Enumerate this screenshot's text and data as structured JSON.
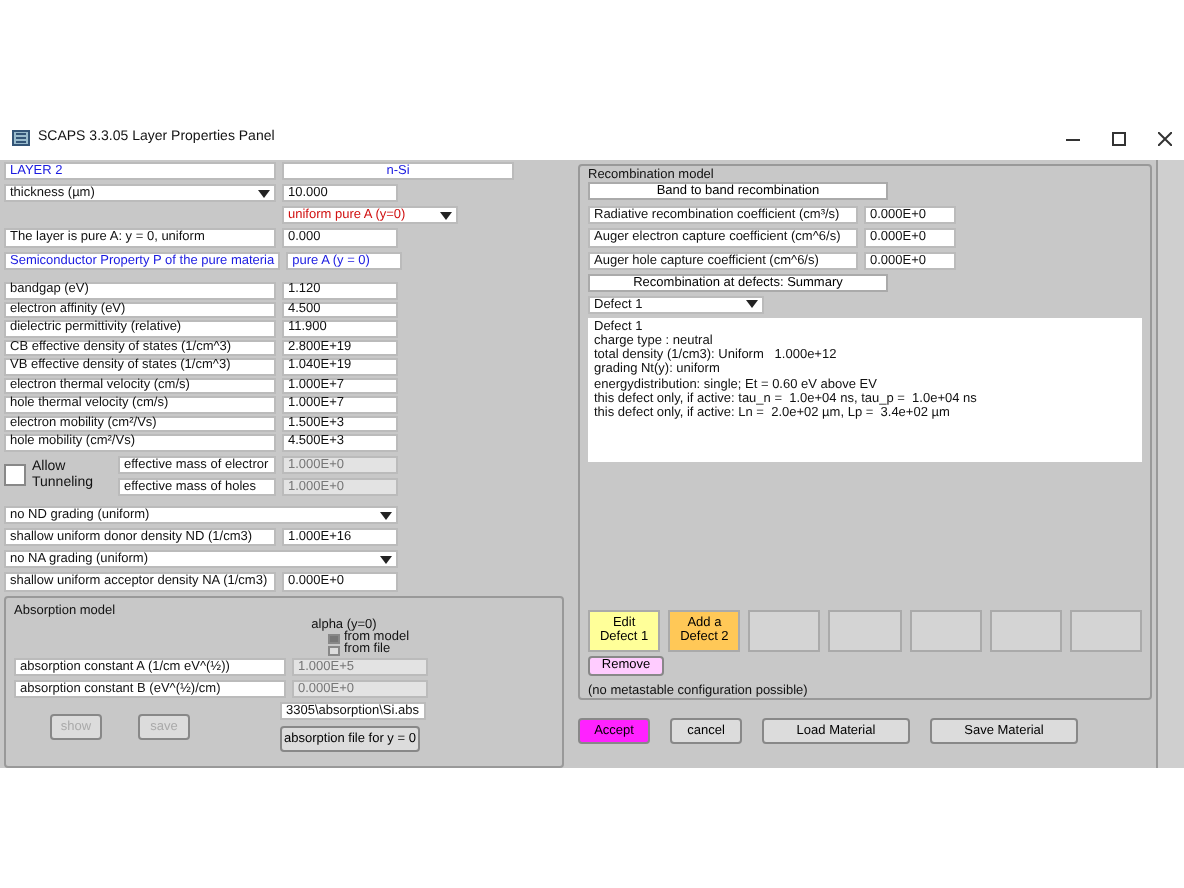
{
  "window": {
    "title": "SCAPS 3.3.05 Layer Properties Panel"
  },
  "layer": {
    "name": "LAYER 2",
    "material": "n-Si",
    "thickness": {
      "label": "thickness (µm)",
      "value": "10.000"
    },
    "grading": "uniform pure A (y=0)",
    "composition": {
      "label": "The layer is pure A: y = 0, uniform",
      "value": "0.000"
    },
    "property_header": {
      "label": "Semiconductor Property P of the pure materia",
      "value": "pure A (y = 0)"
    },
    "properties": [
      {
        "label": "bandgap (eV)",
        "value": "1.120"
      },
      {
        "label": "electron affinity (eV)",
        "value": "4.500"
      },
      {
        "label": "dielectric permittivity (relative)",
        "value": "11.900"
      },
      {
        "label": "CB effective density of states (1/cm^3)",
        "value": "2.800E+19"
      },
      {
        "label": "VB effective density of states (1/cm^3)",
        "value": "1.040E+19"
      },
      {
        "label": "electron thermal velocity (cm/s)",
        "value": "1.000E+7"
      },
      {
        "label": "hole thermal velocity (cm/s)",
        "value": "1.000E+7"
      },
      {
        "label": "electron mobility (cm²/Vs)",
        "value": "1.500E+3"
      },
      {
        "label": "hole mobility (cm²/Vs)",
        "value": "4.500E+3"
      }
    ],
    "tunneling": {
      "label": "Allow Tunneling",
      "checked": false,
      "masses": [
        {
          "label": "effective mass of electror",
          "value": "1.000E+0",
          "disabled": true
        },
        {
          "label": "effective mass of holes",
          "value": "1.000E+0",
          "disabled": true
        }
      ]
    },
    "donor_grading": "no ND grading (uniform)",
    "donor": {
      "label": "shallow uniform donor density ND (1/cm3)",
      "value": "1.000E+16"
    },
    "acceptor_grading": "no NA grading (uniform)",
    "acceptor": {
      "label": "shallow uniform acceptor density NA (1/cm3)",
      "value": "0.000E+0"
    }
  },
  "absorption": {
    "title": "Absorption model",
    "alpha_label": "alpha (y=0)",
    "sources": [
      {
        "label": "from model",
        "selected": true
      },
      {
        "label": "from file",
        "selected": false
      }
    ],
    "constants": [
      {
        "label": "absorption constant A (1/cm eV^(½))",
        "value": "1.000E+5",
        "disabled": true
      },
      {
        "label": "absorption constant B (eV^(½)/cm)",
        "value": "0.000E+0",
        "disabled": true
      }
    ],
    "file_path": "3305\\absorption\\Si.abs",
    "file_button": "absorption file for y = 0",
    "buttons": [
      {
        "label": "show",
        "disabled": true
      },
      {
        "label": "save",
        "disabled": true
      }
    ]
  },
  "recombination": {
    "title": "Recombination model",
    "band_button": "Band to band recombination",
    "coefficients": [
      {
        "label": "Radiative recombination coefficient (cm³/s)",
        "value": "0.000E+0"
      },
      {
        "label": "Auger electron capture coefficient (cm^6/s)",
        "value": "0.000E+0"
      },
      {
        "label": "Auger hole capture coefficient (cm^6/s)",
        "value": "0.000E+0"
      }
    ],
    "defects_button": "Recombination at defects: Summary",
    "defect_select": "Defect 1",
    "defect_summary": [
      "Defect 1",
      "charge type : neutral",
      "total density (1/cm3): Uniform   1.000e+12",
      "grading Nt(y): uniform",
      "energydistribution: single; Et = 0.60 eV above EV",
      "this defect only, if active: tau_n =  1.0e+04 ns, tau_p =  1.0e+04 ns",
      "this defect only, if active: Ln =  2.0e+02 µm, Lp =  3.4e+02 µm"
    ],
    "defect_buttons": [
      {
        "kind": "edit",
        "lines": [
          "Edit",
          "Defect 1"
        ]
      },
      {
        "kind": "add",
        "lines": [
          "Add a",
          "Defect 2"
        ]
      },
      {
        "kind": "empty"
      },
      {
        "kind": "empty"
      },
      {
        "kind": "empty"
      },
      {
        "kind": "empty"
      },
      {
        "kind": "empty"
      }
    ],
    "remove_button": "Remove",
    "note": "(no metastable configuration possible)"
  },
  "footer_buttons": [
    {
      "label": "Accept",
      "kind": "accept"
    },
    {
      "label": "cancel",
      "kind": "plain"
    },
    {
      "label": "Load Material",
      "kind": "wide"
    },
    {
      "label": "Save Material",
      "kind": "wide"
    }
  ]
}
